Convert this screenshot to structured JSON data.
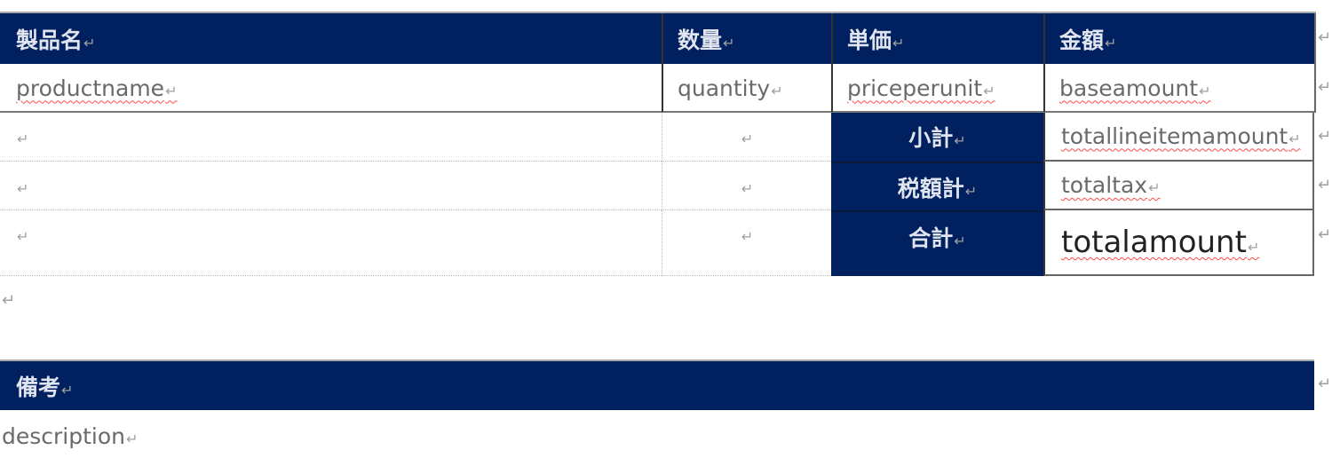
{
  "table": {
    "headers": [
      "製品名",
      "数量",
      "単価",
      "金額"
    ],
    "row": {
      "productname": "productname",
      "quantity": "quantity",
      "priceperunit": "priceperunit",
      "baseamount": "baseamount"
    },
    "summary": [
      {
        "label": "小計",
        "value": "totallineitemamount"
      },
      {
        "label": "税額計",
        "value": "totaltax"
      },
      {
        "label": "合計",
        "value": "totalamount"
      }
    ]
  },
  "remarks": {
    "header": "備考",
    "value": "description"
  },
  "colors": {
    "header_bg": "#002060",
    "header_text": "#dfe4ef",
    "spell_underline": "#ff4a4a"
  }
}
